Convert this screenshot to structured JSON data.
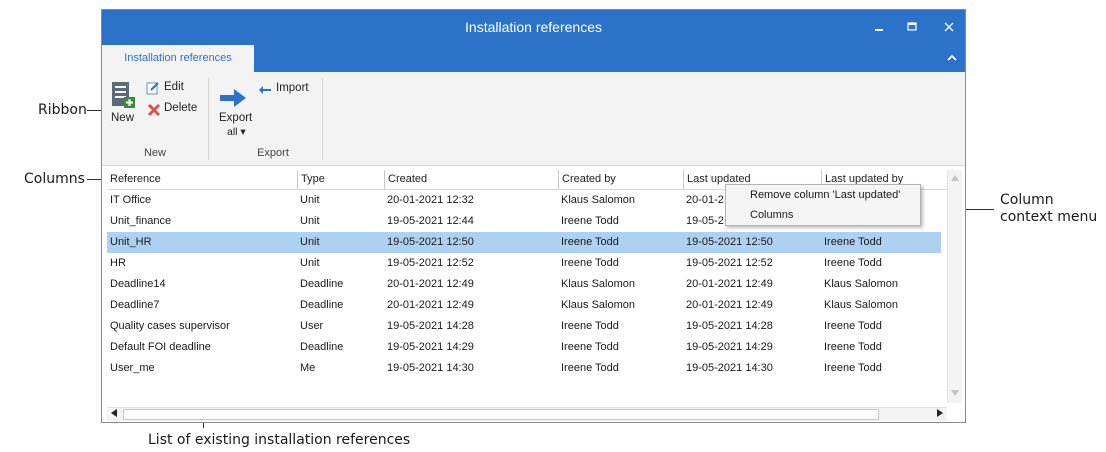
{
  "window": {
    "title": "Installation references",
    "minimize_glyph": "▬",
    "maximize_glyph": "□",
    "close_glyph": "✕",
    "accent_color": "#2b72c8"
  },
  "tab": {
    "label": "Installation references",
    "collapse_glyph": "⌃"
  },
  "ribbon": {
    "new_label": "New",
    "edit_label": "Edit",
    "delete_label": "Delete",
    "new_group_label": "New",
    "export_label_line1": "Export",
    "export_label_line2": "all ▾",
    "import_label": "Import",
    "export_group_label": "Export"
  },
  "grid": {
    "columns": [
      "Reference",
      "Type",
      "Created",
      "Created by",
      "Last updated",
      "Last updated by"
    ],
    "rows": [
      [
        "IT Office",
        "Unit",
        "20-01-2021 12:32",
        "Klaus Salomon",
        "20-01-2",
        ""
      ],
      [
        "Unit_finance",
        "Unit",
        "19-05-2021 12:44",
        "Ireene Todd",
        "19-05-2",
        ""
      ],
      [
        "Unit_HR",
        "Unit",
        "19-05-2021 12:50",
        "Ireene Todd",
        "19-05-2021 12:50",
        "Ireene Todd"
      ],
      [
        "HR",
        "Unit",
        "19-05-2021 12:52",
        "Ireene Todd",
        "19-05-2021 12:52",
        "Ireene Todd"
      ],
      [
        "Deadline14",
        "Deadline",
        "20-01-2021 12:49",
        "Klaus Salomon",
        "20-01-2021 12:49",
        "Klaus Salomon"
      ],
      [
        "Deadline7",
        "Deadline",
        "20-01-2021 12:49",
        "Klaus Salomon",
        "20-01-2021 12:49",
        "Klaus Salomon"
      ],
      [
        "Quality cases supervisor",
        "User",
        "19-05-2021 14:28",
        "Ireene Todd",
        "19-05-2021 14:28",
        "Ireene Todd"
      ],
      [
        "Default FOI deadline",
        "Deadline",
        "19-05-2021 14:29",
        "Ireene Todd",
        "19-05-2021 14:29",
        "Ireene Todd"
      ],
      [
        "User_me",
        "Me",
        "19-05-2021 14:30",
        "Ireene Todd",
        "19-05-2021 14:30",
        "Ireene Todd"
      ]
    ],
    "selected_row": 2,
    "selected_color": "#acd1f2"
  },
  "context_menu": {
    "items": [
      "Remove column 'Last updated'",
      "Columns"
    ]
  },
  "callouts": {
    "ribbon": "Ribbon",
    "columns": "Columns",
    "context_menu_line1": "Column",
    "context_menu_line2": "context menu",
    "list": "List of existing installation references"
  }
}
